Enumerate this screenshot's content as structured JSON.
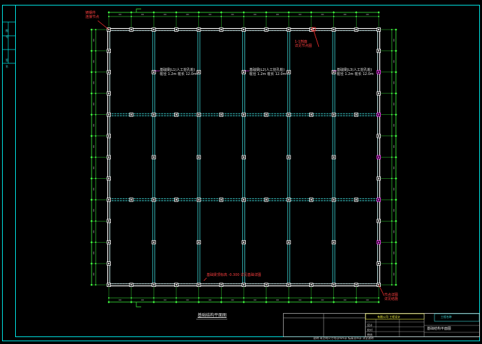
{
  "drawing": {
    "title": "基础结构平面图",
    "colors": {
      "background": "#000000",
      "frame": "#00e5e5",
      "beam": "#ffffff",
      "grid_line": "#40e0e0",
      "column": "#ffffff",
      "column_special": "#ff40ff",
      "dimension": "#40ff40",
      "annotation_red": "#ff3030"
    },
    "grid": {
      "columns_count": 13,
      "rows_count": 13,
      "major_x_count": 7,
      "major_y_count": 3
    },
    "annotations": [
      {
        "id": "ann-top-left",
        "text_lines": [
          "铸钢件",
          "连接节点"
        ],
        "style": "red"
      },
      {
        "id": "ann-top-right",
        "text_lines": [
          "1-1剖面",
          "详见节点图"
        ],
        "style": "red"
      },
      {
        "id": "ann-bay-1",
        "text_lines": [
          "基础梁JL1(人工挖孔桩)",
          "桩径 1.2m 桩长 12.0m"
        ],
        "style": "white"
      },
      {
        "id": "ann-bay-2",
        "text_lines": [
          "基础梁JL2(人工挖孔桩)",
          "桩径 1.2m 桩长 12.0m"
        ],
        "style": "white"
      },
      {
        "id": "ann-bay-3",
        "text_lines": [
          "基础梁JL3(人工挖孔桩)",
          "桩径 1.2m 桩长 12.0m"
        ],
        "style": "white"
      },
      {
        "id": "ann-bottom-mid",
        "text_lines": [
          "基础梁顶标高 -0.300 详见基础详图"
        ],
        "style": "red"
      },
      {
        "id": "ann-bottom-right",
        "text_lines": [
          "节点详图",
          "详见结施"
        ],
        "style": "red"
      }
    ],
    "title_block": {
      "company_line": "有限公司 工程设计",
      "project_label": "工程名称",
      "sheet_title": "基础结构平面图",
      "rows": [
        "设计",
        "校对",
        "审核",
        "审定"
      ],
      "footer": "说明 未注明尺寸均以mm计 标高以m计 详见说明"
    },
    "left_strip": {
      "labels": [
        "图",
        "号",
        "签",
        "名"
      ]
    }
  }
}
